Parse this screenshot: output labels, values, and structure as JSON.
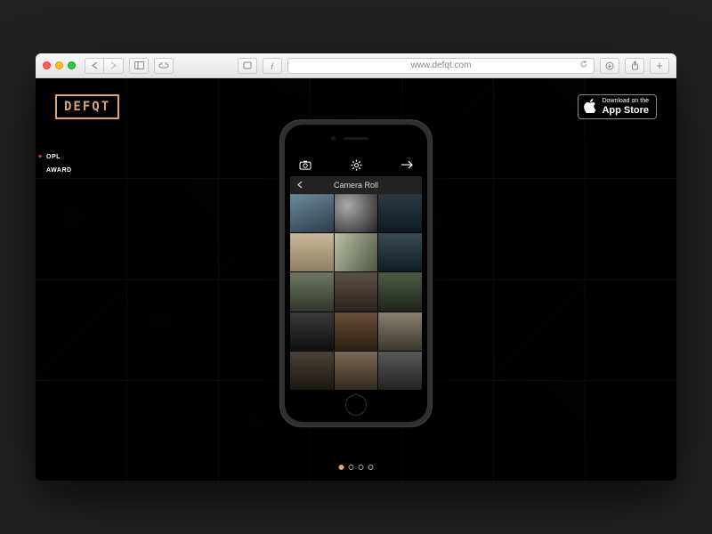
{
  "browser": {
    "url": "www.defqt.com"
  },
  "page": {
    "logo": "DEFQT",
    "appstore_small": "Download on the",
    "appstore_big": "App Store",
    "badges": [
      "OPL",
      "AWARD"
    ],
    "pager": {
      "count": 4,
      "active": 0
    }
  },
  "phone": {
    "subtitle": "Camera Roll"
  }
}
